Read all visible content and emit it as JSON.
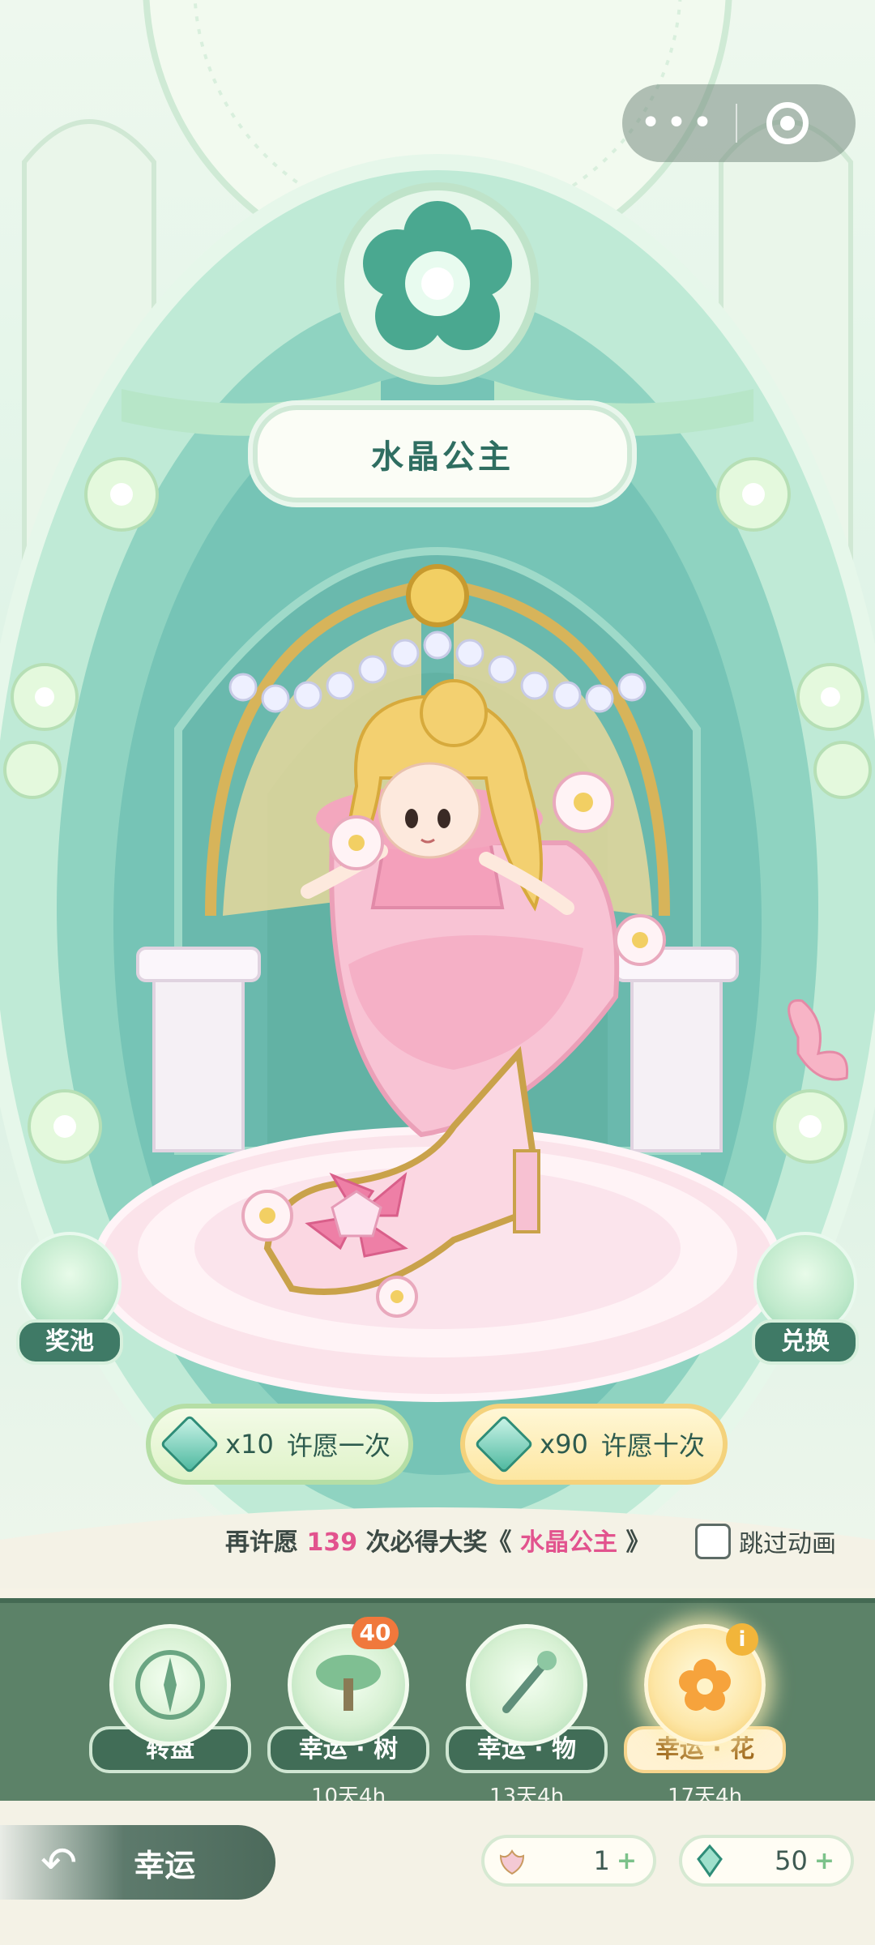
{
  "header": {
    "more_icon": "more-dots-icon",
    "close_icon": "target-close-icon"
  },
  "banner": {
    "title": "水晶公主"
  },
  "side_buttons": {
    "pool_label": "奖池",
    "exchange_label": "兑换"
  },
  "wish": {
    "single": {
      "cost": "x10",
      "label": "许愿一次"
    },
    "ten": {
      "cost": "x90",
      "label": "许愿十次"
    }
  },
  "notice": {
    "prefix": "再许愿",
    "count": "139",
    "middle": "次必得大奖《",
    "prize": "水晶公主",
    "suffix": "》"
  },
  "skip": {
    "label": "跳过动画",
    "checked": false
  },
  "tabs": [
    {
      "label": "转盘",
      "sub": "",
      "icon": "compass-icon"
    },
    {
      "label": "幸运 · 树",
      "sub": "10天4h",
      "icon": "bonsai-tree-icon",
      "badge": "40"
    },
    {
      "label": "幸运 · 物",
      "sub": "13天4h",
      "icon": "brush-icon"
    },
    {
      "label": "幸运 · 花",
      "sub": "17天4h",
      "icon": "flower-icon",
      "active": true
    }
  ],
  "bottom": {
    "back_label": "幸运",
    "currency": [
      {
        "icon": "lotus-token-icon",
        "value": "1"
      },
      {
        "icon": "crystal-gem-icon",
        "value": "50"
      }
    ]
  },
  "colors": {
    "accent_green": "#3f7a66",
    "pink": "#e2538e",
    "tab_bar": "#5c8268"
  }
}
